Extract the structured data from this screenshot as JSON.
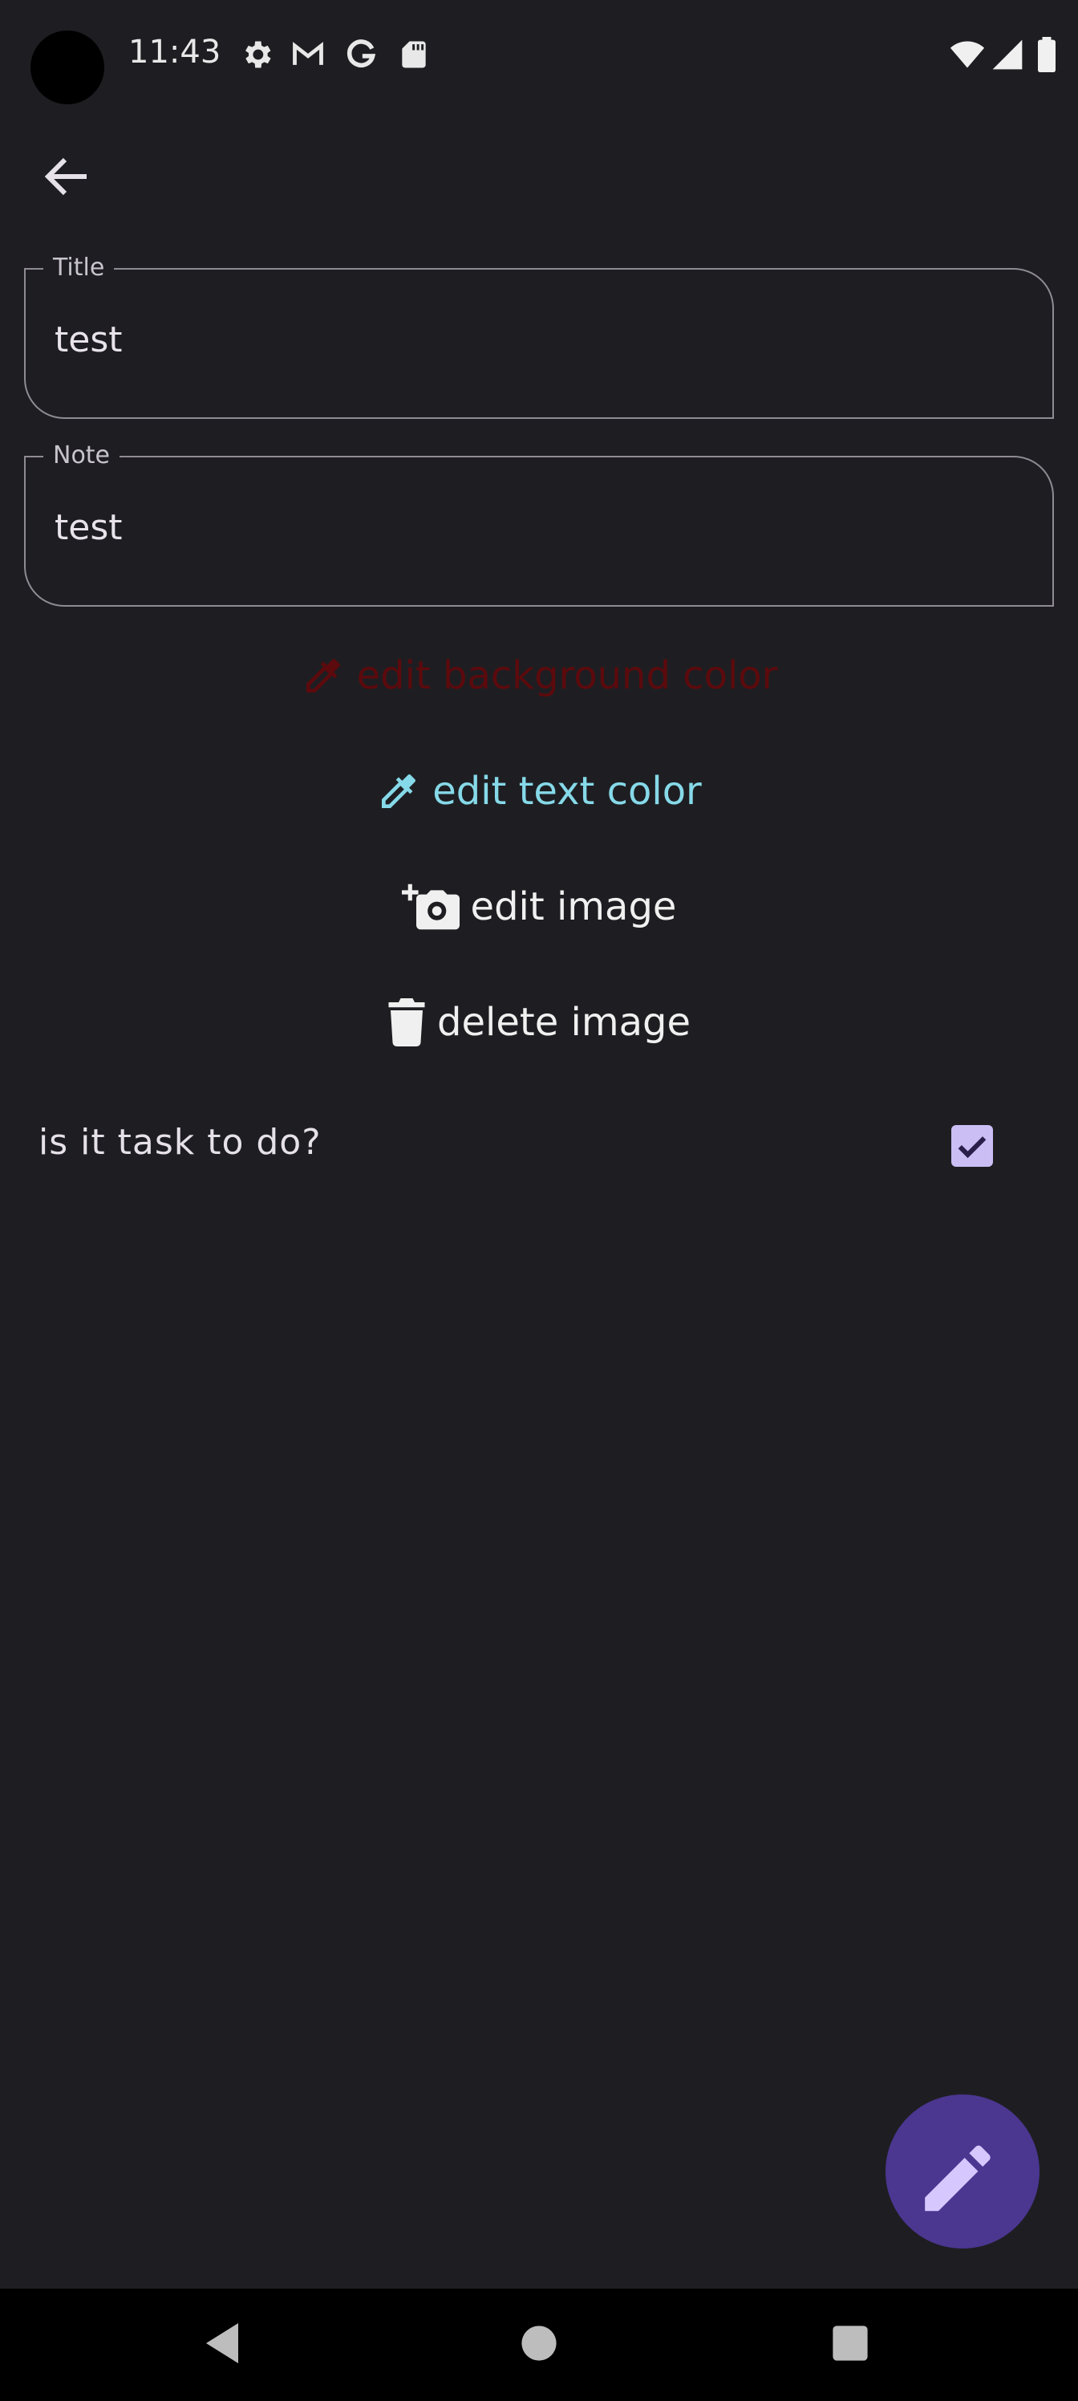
{
  "status_bar": {
    "time": "11:43",
    "icons": [
      "settings-icon",
      "gmail-icon",
      "google-icon",
      "sd-card-icon",
      "wifi-icon",
      "signal-icon",
      "battery-icon"
    ]
  },
  "toolbar": {
    "back_icon": "arrow-back-icon"
  },
  "form": {
    "title": {
      "label": "Title",
      "value": "test"
    },
    "note": {
      "label": "Note",
      "value": "test"
    }
  },
  "actions": {
    "edit_background": {
      "label": "edit background color",
      "icon": "eyedropper-icon",
      "color": "#5c0a0d"
    },
    "edit_text": {
      "label": "edit text color",
      "icon": "eyedropper-icon",
      "color": "#86d9e8"
    },
    "edit_image": {
      "label": "edit image",
      "icon": "add-camera-icon"
    },
    "delete_image": {
      "label": "delete image",
      "icon": "trash-icon"
    }
  },
  "task": {
    "label": "is it task to do?",
    "checked": true,
    "accent": "#cbbef5"
  },
  "fab": {
    "icon": "pencil-icon",
    "color": "#4b3690"
  },
  "nav": {
    "icons": [
      "back-triangle-icon",
      "home-circle-icon",
      "recents-square-icon"
    ]
  }
}
